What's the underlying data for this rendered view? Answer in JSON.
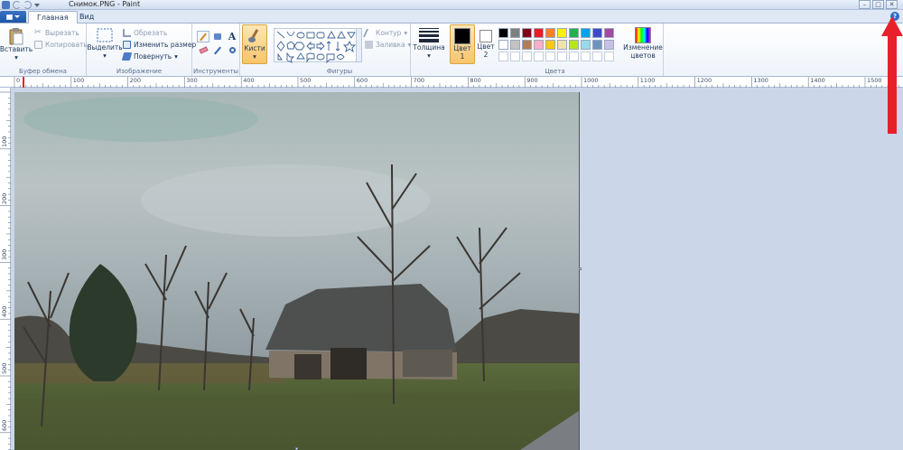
{
  "window": {
    "title": "Снимок.PNG - Paint"
  },
  "tabs": [
    {
      "label": "Главная",
      "active": true
    },
    {
      "label": "Вид",
      "active": false
    }
  ],
  "clipboard": {
    "paste": "Вставить",
    "cut": "Вырезать",
    "copy": "Копировать",
    "group": "Буфер обмена"
  },
  "image": {
    "select": "Выделить",
    "crop": "Обрезать",
    "resize": "Изменить размер",
    "rotate": "Повернуть",
    "group": "Изображение"
  },
  "tools": {
    "group": "Инструменты",
    "brushes": "Кисти"
  },
  "shapes": {
    "group": "Фигуры",
    "outline": "Контур",
    "fill": "Заливка"
  },
  "size": {
    "label": "Толщина"
  },
  "colors": {
    "color1": "Цвет 1",
    "color1_top": "Цвет",
    "color1_bottom": "1",
    "color2_top": "Цвет",
    "color2_bottom": "2",
    "edit_top": "Изменение",
    "edit_bottom": "цветов",
    "group": "Цвета",
    "palette_row1": [
      "#000000",
      "#7f7f7f",
      "#880015",
      "#ed1c24",
      "#ff7f27",
      "#fff200",
      "#22b14c",
      "#00a2e8",
      "#3f48cc",
      "#a349a4"
    ],
    "palette_row2": [
      "#ffffff",
      "#c3c3c3",
      "#b97a57",
      "#ffaec9",
      "#ffc90e",
      "#efe4b0",
      "#b5e61d",
      "#99d9ea",
      "#7092be",
      "#c8bfe7"
    ]
  },
  "ruler": {
    "h_ticks": [
      "0",
      "100",
      "200",
      "300",
      "400",
      "500",
      "600",
      "700",
      "800",
      "900",
      "1000",
      "1100",
      "1200",
      "1300",
      "1400",
      "1500"
    ],
    "v_ticks": [
      "100",
      "200",
      "300",
      "400",
      "500",
      "600"
    ]
  },
  "accent": "#e8202a"
}
